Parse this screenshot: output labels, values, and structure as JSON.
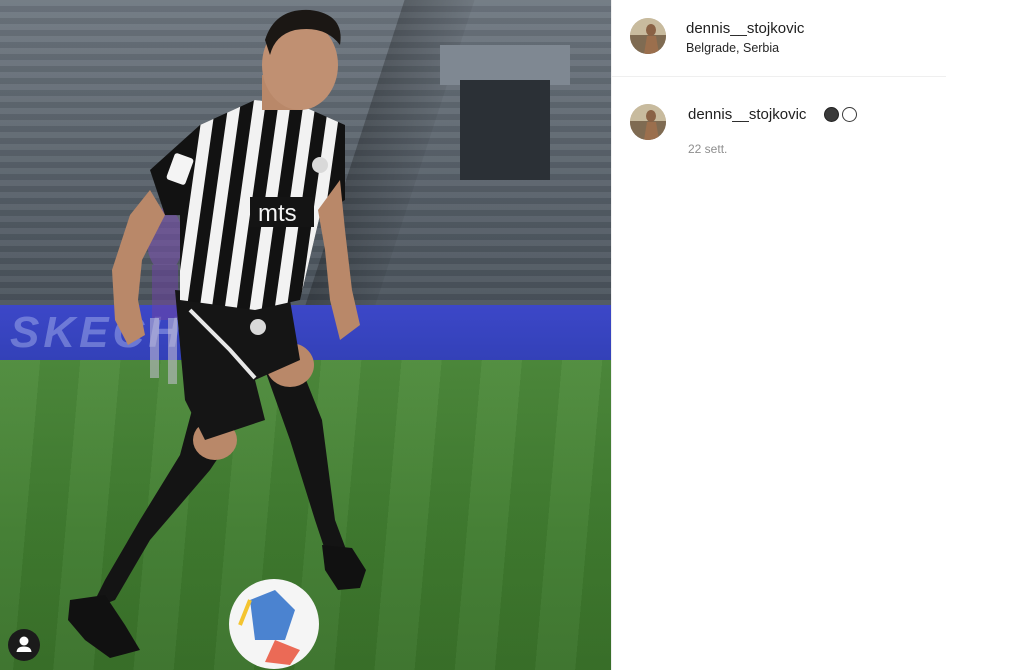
{
  "post": {
    "author": "dennis__stojkovic",
    "location": "Belgrade, Serbia",
    "caption": {
      "username": "dennis__stojkovic",
      "emoji": [
        "black-circle",
        "white-circle"
      ],
      "date": "22 sett."
    }
  },
  "photo": {
    "banner_text": "SKECHERS",
    "jersey_sponsor": "mts"
  },
  "colors": {
    "text": "#262626",
    "secondary_text": "#8e8e8e",
    "divider": "#efefef"
  }
}
